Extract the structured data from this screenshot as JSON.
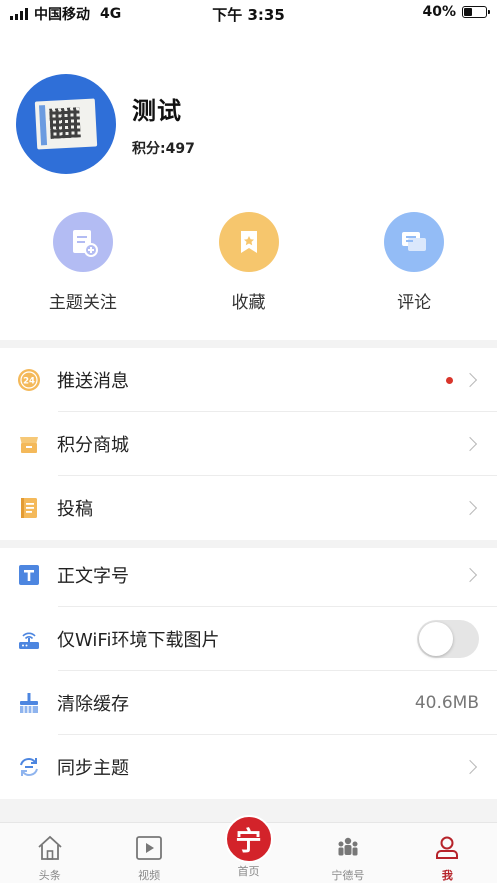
{
  "status_bar": {
    "carrier": "中国移动",
    "network": "4G",
    "time": "下午 3:35",
    "battery_text": "40%",
    "battery_level": 0.4
  },
  "profile": {
    "username": "测试",
    "points": "积分:497"
  },
  "quick_actions": [
    {
      "label": "主题关注",
      "icon": "topic-follow-icon",
      "color": "#a9b3f0"
    },
    {
      "label": "收藏",
      "icon": "bookmark-icon",
      "color": "#f5c56a"
    },
    {
      "label": "评论",
      "icon": "comment-icon",
      "color": "#8db8f5"
    }
  ],
  "menu_group_1": [
    {
      "label": "推送消息",
      "icon": "push-message-icon",
      "has_dot": true
    },
    {
      "label": "积分商城",
      "icon": "points-mall-icon"
    },
    {
      "label": "投稿",
      "icon": "contribute-icon"
    }
  ],
  "menu_group_2": {
    "font_size": {
      "label": "正文字号",
      "icon": "text-size-icon"
    },
    "wifi_images": {
      "label": "仅WiFi环境下载图片",
      "icon": "wifi-router-icon",
      "enabled": false
    },
    "clear_cache": {
      "label": "清除缓存",
      "icon": "broom-icon",
      "value": "40.6MB"
    },
    "sync_topics": {
      "label": "同步主题",
      "icon": "sync-icon"
    }
  },
  "icon_badge_text": "24",
  "tabbar": {
    "items": [
      {
        "label": "头条",
        "icon": "house-icon"
      },
      {
        "label": "视频",
        "icon": "video-icon"
      },
      {
        "label": "首页",
        "icon": "home-logo-icon",
        "glyph": "宁"
      },
      {
        "label": "宁德号",
        "icon": "people-icon"
      },
      {
        "label": "我",
        "icon": "user-icon"
      }
    ],
    "active_color": "#b6232a"
  }
}
